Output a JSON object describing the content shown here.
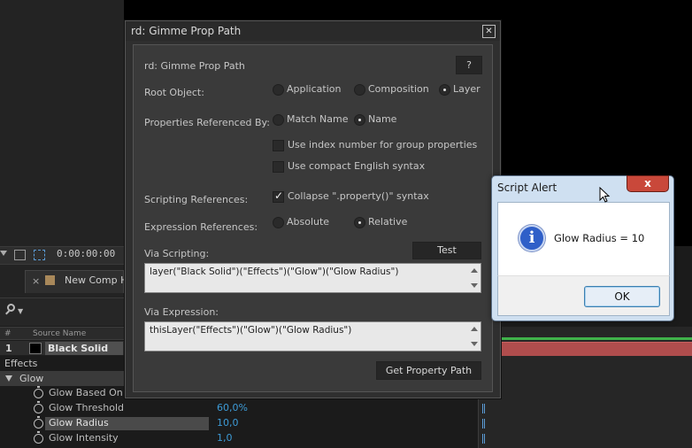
{
  "background": {
    "timecode": "0:00:00:00",
    "comp_tab": {
      "label": "New Comp H"
    },
    "columns": {
      "number": "#",
      "source_name": "Source Name"
    },
    "layer": {
      "number": "1",
      "name": "Black Solid"
    },
    "effects_label": "Effects",
    "glow_label": "Glow",
    "properties": [
      {
        "name": "Glow Based On",
        "value": ""
      },
      {
        "name": "Glow Threshold",
        "value": "60,0%"
      },
      {
        "name": "Glow Radius",
        "value": "10,0"
      },
      {
        "name": "Glow Intensity",
        "value": "1,0"
      }
    ]
  },
  "dialog": {
    "window_title": "rd: Gimme Prop Path",
    "heading": "rd: Gimme Prop Path",
    "help_label": "?",
    "root_object": {
      "label": "Root Object:",
      "options": [
        "Application",
        "Composition",
        "Layer"
      ],
      "selected": "Layer"
    },
    "properties_by": {
      "label": "Properties Referenced By:",
      "options": [
        "Match Name",
        "Name"
      ],
      "selected": "Name"
    },
    "use_index": {
      "label": "Use index number for group properties",
      "checked": false
    },
    "use_compact": {
      "label": "Use compact English syntax",
      "checked": false
    },
    "scripting_refs": {
      "label": "Scripting References:",
      "collapse_label": "Collapse \".property()\" syntax",
      "checked": true
    },
    "expression_refs": {
      "label": "Expression References:",
      "options": [
        "Absolute",
        "Relative"
      ],
      "selected": "Relative"
    },
    "via_scripting": {
      "label": "Via Scripting:",
      "test_label": "Test",
      "value": "layer(\"Black Solid\")(\"Effects\")(\"Glow\")(\"Glow Radius\")"
    },
    "via_expression": {
      "label": "Via Expression:",
      "value": "thisLayer(\"Effects\")(\"Glow\")(\"Glow Radius\")"
    },
    "get_path_label": "Get Property Path"
  },
  "alert": {
    "title": "Script Alert",
    "close_label": "x",
    "message": "Glow Radius = 10",
    "ok_label": "OK"
  }
}
